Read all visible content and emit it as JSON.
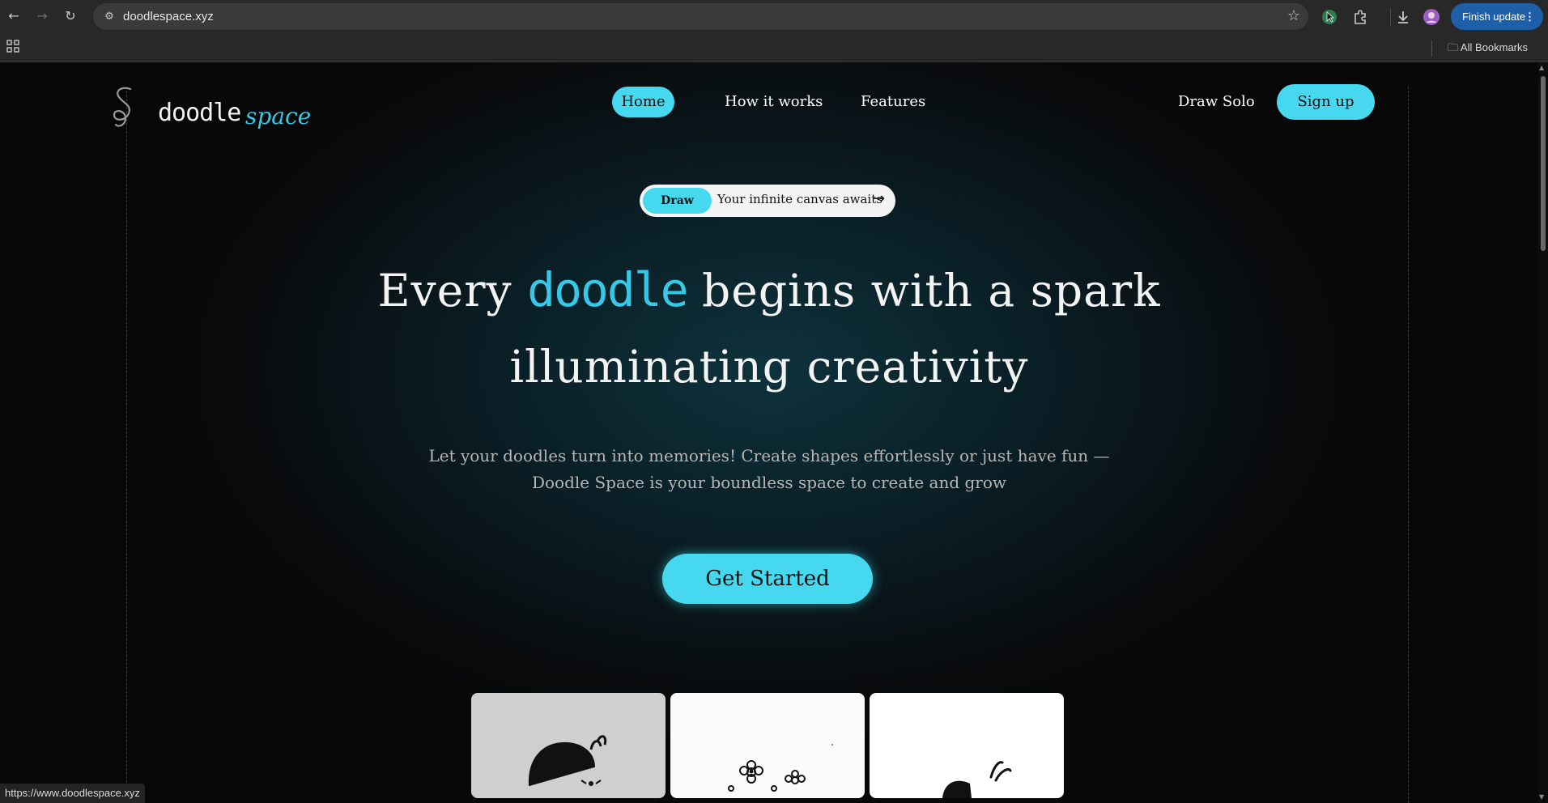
{
  "browser": {
    "url": "doodlespace.xyz",
    "finish_update_label": "Finish update",
    "all_bookmarks_label": "All Bookmarks",
    "status_url": "https://www.doodlespace.xyz"
  },
  "header": {
    "logo_word": "doodle",
    "logo_accent": "space",
    "nav": {
      "home": "Home",
      "how": "How it works",
      "features": "Features"
    },
    "draw_solo": "Draw Solo",
    "signup": "Sign up"
  },
  "hero": {
    "pill_tag": "Draw",
    "pill_text": "Your infinite canvas awaits",
    "title_pre": "Every ",
    "title_accent": "doodle",
    "title_post": " begins with a spark",
    "title_line2": "illuminating creativity",
    "sub_line1": "Let your doodles turn into memories! Create shapes effortlessly or just have fun —",
    "sub_line2": "Doodle Space is your boundless space to create and grow",
    "cta": "Get Started"
  },
  "colors": {
    "accent": "#45d8ef",
    "accent_text": "#36c8e6",
    "background": "#090b0d",
    "chrome": "#282828"
  }
}
